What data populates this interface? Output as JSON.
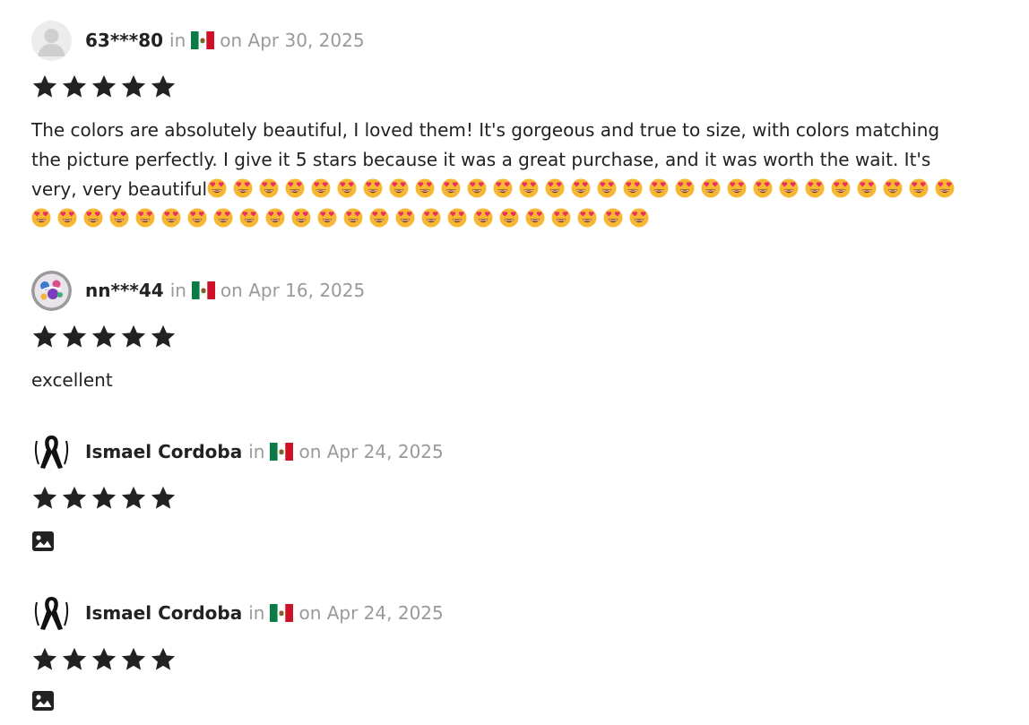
{
  "colors": {
    "text": "#222222",
    "muted": "#9a9a9a",
    "star": "#222222"
  },
  "reviews": [
    {
      "avatar": "default-avatar-icon",
      "name": "63***80",
      "in": "in",
      "flag": "mexico-flag-icon",
      "date": "on Apr 30, 2025",
      "rating": 5,
      "text": "The colors are absolutely beautiful, I loved them! It's gorgeous and true to size, with colors matching the picture perfectly. I give it 5 stars because it was a great purchase, and it was worth the wait. It's very, very beautiful",
      "emoji": "heart-eyes-emoji",
      "emoji_count": 53
    },
    {
      "avatar": "user-photo-avatar",
      "name": "nn***44",
      "in": "in",
      "flag": "mexico-flag-icon",
      "date": "on Apr 16, 2025",
      "rating": 5,
      "text": "excellent"
    },
    {
      "avatar": "black-ribbon-avatar",
      "name": "Ismael Cordoba",
      "in": "in",
      "flag": "mexico-flag-icon",
      "date": "on Apr 24, 2025",
      "rating": 5,
      "attachment": "image-icon"
    },
    {
      "avatar": "black-ribbon-avatar",
      "name": "Ismael Cordoba",
      "in": "in",
      "flag": "mexico-flag-icon",
      "date": "on Apr 24, 2025",
      "rating": 5,
      "attachment": "image-icon"
    }
  ]
}
